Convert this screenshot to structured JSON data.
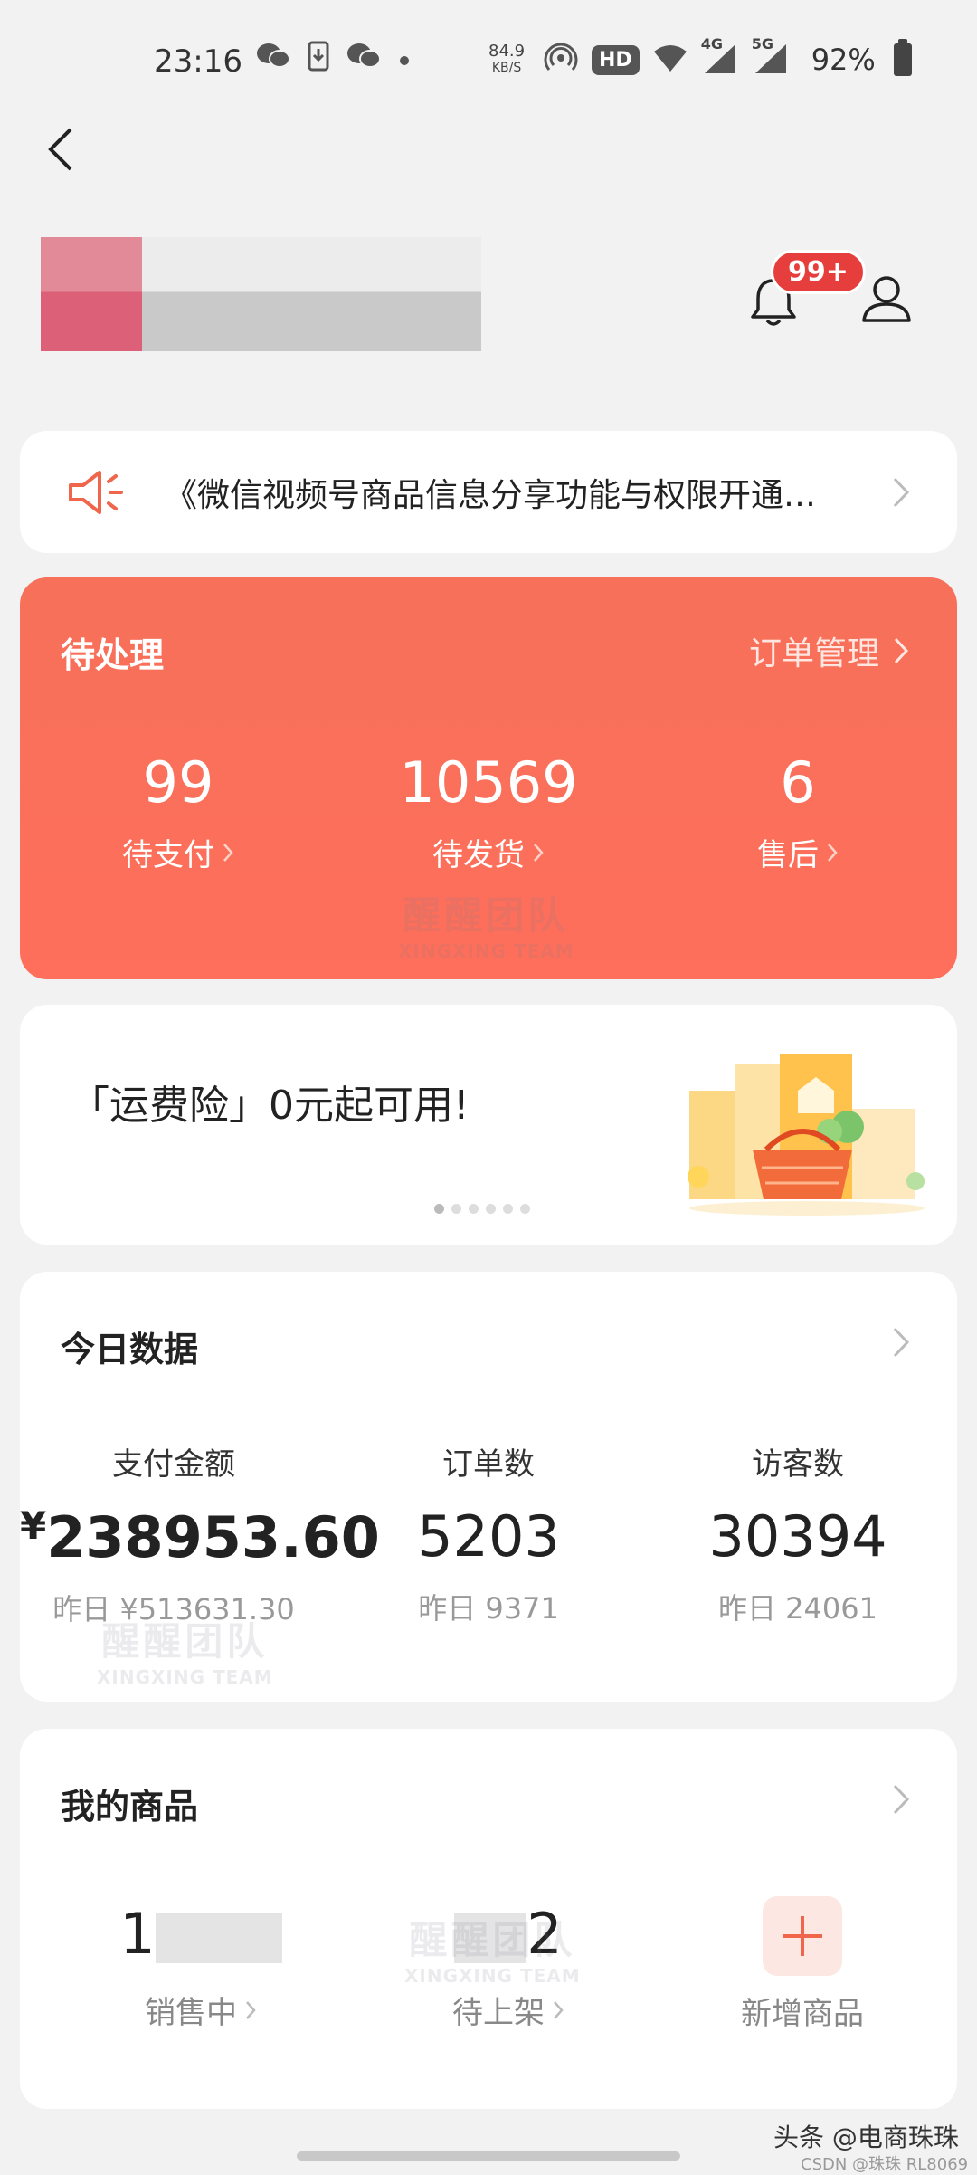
{
  "status_bar": {
    "time": "23:16",
    "net_speed": "84.9",
    "net_unit": "KB/S",
    "hd": "HD",
    "sim1": "4G",
    "sim2": "5G",
    "battery": "92%"
  },
  "header": {
    "notification_badge": "99+"
  },
  "notice": {
    "text": "《微信视频号商品信息分享功能与权限开通…"
  },
  "pending": {
    "title": "待处理",
    "link": "订单管理",
    "stats": [
      {
        "value": "99",
        "label": "待支付"
      },
      {
        "value": "10569",
        "label": "待发货"
      },
      {
        "value": "6",
        "label": "售后"
      }
    ],
    "watermark_cn": "醒醒团队",
    "watermark_en": "XINGXING TEAM"
  },
  "banner": {
    "text": "「运费险」0元起可用!",
    "page_index": 0,
    "page_count": 6
  },
  "today": {
    "title": "今日数据",
    "metrics": [
      {
        "label": "支付金额",
        "currency": "¥",
        "value": "238953.60",
        "yesterday": "昨日 ¥513631.30"
      },
      {
        "label": "订单数",
        "value": "5203",
        "yesterday": "昨日 9371"
      },
      {
        "label": "访客数",
        "value": "30394",
        "yesterday": "昨日 24061"
      }
    ]
  },
  "goods": {
    "title": "我的商品",
    "items": [
      {
        "value": "1",
        "label": "销售中"
      },
      {
        "value": "2",
        "label": "待上架"
      },
      {
        "label": "新增商品"
      }
    ]
  },
  "footer": {
    "watermark": "头条 @电商珠珠",
    "watermark2": "CSDN @珠珠 RL8069"
  },
  "colors": {
    "accent": "#f6705a",
    "badge": "#e63d3d",
    "background": "#f2f2f2"
  }
}
